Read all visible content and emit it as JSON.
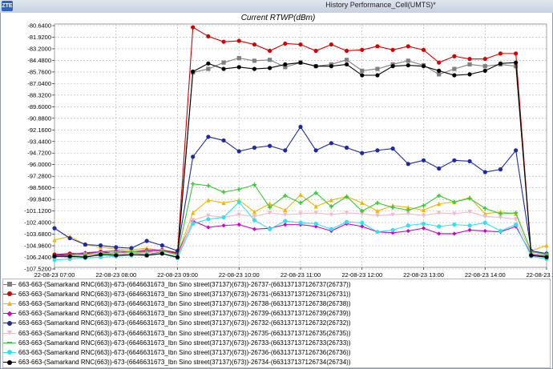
{
  "window": {
    "title": "History Performance_Cell(UMTS)*",
    "icon": "zte-logo-icon",
    "icon_text": "ZTE"
  },
  "chart_data": {
    "type": "line",
    "title": "Current RTWP(dBm)",
    "xlabel": "",
    "ylabel": "",
    "x_ticks": [
      "22-08-23 07:00",
      "22-08-23 08:00",
      "22-08-23 09:00",
      "22-08-23 10:00",
      "22-08-23 11:00",
      "22-08-23 12:00",
      "22-08-23 13:00",
      "22-08-23 14:00",
      "22-08-23 15:00"
    ],
    "y_ticks": [
      "-80.6400",
      "-81.9200",
      "-83.2000",
      "-84.4800",
      "-85.7600",
      "-87.0400",
      "-88.3200",
      "-89.6000",
      "-90.8800",
      "-92.1600",
      "-93.4400",
      "-94.7200",
      "-96.0000",
      "-97.2800",
      "-98.5600",
      "-99.8400",
      "-101.1200",
      "-102.4000",
      "-103.6800",
      "-104.9600",
      "-106.2400",
      "-107.5200"
    ],
    "ylim": [
      -107.52,
      -80.64
    ],
    "x_range_hours": [
      7.0,
      15.0
    ],
    "x_start_date": "22-08-23",
    "grid": true,
    "legend_position": "bottom",
    "x": [
      7.0,
      7.25,
      7.5,
      7.75,
      8.0,
      8.25,
      8.5,
      8.75,
      9.0,
      9.25,
      9.5,
      9.75,
      10.0,
      10.25,
      10.5,
      10.75,
      11.0,
      11.25,
      11.5,
      11.75,
      12.0,
      12.25,
      12.5,
      12.75,
      13.0,
      13.25,
      13.5,
      13.75,
      14.0,
      14.25,
      14.5,
      14.75,
      15.0
    ],
    "series": [
      {
        "name": "663-663-(Samarkand RNC(663))-673-(6646631673_Ibn Sino street(37137)(673))-26737-(66313713712673​7(26737))",
        "color": "#808080",
        "marker": "square",
        "values": [
          -106.3,
          -106.4,
          -106.3,
          -106.2,
          -106.0,
          -105.9,
          -106.1,
          -105.8,
          -105.9,
          -86.0,
          -85.6,
          -84.9,
          -84.4,
          -84.7,
          -84.6,
          -85.4,
          -84.9,
          -85.3,
          -85.1,
          -84.6,
          -85.8,
          -85.6,
          -85.1,
          -84.7,
          -85.2,
          -86.2,
          -85.6,
          -85.1,
          -85.3,
          -85.1,
          -85.3,
          -106.0,
          -106.2
        ]
      },
      {
        "name": "663-663-(Samarkand RNC(663))-673-(6646631673_Ibn Sino street(37137)(673))-26731-(663137137126731(26731))",
        "color": "#d80000",
        "marker": "circle",
        "values": [
          -106.1,
          -106.0,
          -106.0,
          -105.8,
          -106.0,
          -105.9,
          -105.8,
          -105.6,
          -105.9,
          -81.0,
          -82.0,
          -82.6,
          -82.5,
          -82.9,
          -83.6,
          -82.8,
          -82.9,
          -83.6,
          -82.9,
          -83.6,
          -83.5,
          -83.1,
          -83.5,
          -83.1,
          -83.5,
          -84.9,
          -84.2,
          -84.5,
          -84.5,
          -83.9,
          -83.9,
          -106.1,
          -106.3
        ]
      },
      {
        "name": "663-663-(Samarkand RNC(663))-673-(6646631673_Ibn Sino street(37137)(673))-26738-(663137137126738(26738))",
        "color": "#f0b800",
        "marker": "triangle",
        "values": [
          -104.5,
          -104.1,
          -105.0,
          -105.3,
          -105.5,
          -105.6,
          -105.4,
          -105.7,
          -106.1,
          -101.5,
          -100.1,
          -100.4,
          -100.1,
          -101.4,
          -100.5,
          -101.2,
          -99.5,
          -100.8,
          -100.1,
          -99.7,
          -100.4,
          -101.3,
          -100.7,
          -100.9,
          -101.2,
          -100.5,
          -100.3,
          -99.8,
          -101.6,
          -101.4,
          -101.6,
          -105.7,
          -105.1
        ]
      },
      {
        "name": "663-663-(Samarkand RNC(663))-673-(6646631673_Ibn Sino street(37137)(673))-26739-(663137137126739(26739))",
        "color": "#d000d0",
        "marker": "diamond",
        "values": [
          -106.2,
          -106.1,
          -105.9,
          -105.8,
          -105.7,
          -105.8,
          -105.6,
          -105.6,
          -106.0,
          -102.4,
          -103.1,
          -102.9,
          -102.8,
          -103.3,
          -103.2,
          -102.8,
          -102.8,
          -103.0,
          -103.5,
          -102.7,
          -103.0,
          -103.6,
          -103.7,
          -103.5,
          -103.2,
          -103.8,
          -103.8,
          -103.4,
          -103.5,
          -103.6,
          -103.0,
          -106.1,
          -106.2
        ]
      },
      {
        "name": "663-663-(Samarkand RNC(663))-673-(6646631673_Ibn Sino street(37137)(673))-26732-(663137137126732(26732))",
        "color": "#1a2aa8",
        "marker": "circle",
        "values": [
          -103.2,
          -104.3,
          -105.0,
          -105.1,
          -105.3,
          -105.4,
          -104.6,
          -105.1,
          -105.7,
          -95.3,
          -93.1,
          -93.5,
          -94.7,
          -94.3,
          -94.1,
          -94.6,
          -92.0,
          -94.6,
          -93.8,
          -94.3,
          -94.9,
          -94.6,
          -94.4,
          -96.1,
          -95.7,
          -96.6,
          -95.7,
          -95.8,
          -97.0,
          -96.7,
          -94.6,
          -105.7,
          -106.0
        ]
      },
      {
        "name": "663-663-(Samarkand RNC(663))-673-(6646631673_Ibn Sino street(37137)(673))-26735-(663137137126735(26735))",
        "color": "#f4b8c8",
        "marker": "triangle-down",
        "values": [
          -106.4,
          -106.3,
          -106.1,
          -106.0,
          -106.0,
          -105.9,
          -105.9,
          -105.7,
          -106.3,
          -102.3,
          -101.8,
          -102.0,
          -101.7,
          -101.9,
          -101.5,
          -101.7,
          -101.6,
          -101.5,
          -101.7,
          -101.5,
          -101.6,
          -101.8,
          -101.7,
          -101.6,
          -101.8,
          -101.5,
          -101.6,
          -101.4,
          -101.9,
          -102.0,
          -102.2,
          -106.0,
          -106.2
        ]
      },
      {
        "name": "663-663-(Samarkand RNC(663))-673-(6646631673_Ibn Sino street(37137)(673))-26733-(663137137126733(26733))",
        "color": "#33cc33",
        "marker": "cross",
        "values": [
          -106.3,
          -106.2,
          -106.1,
          -106.0,
          -105.9,
          -105.8,
          -105.7,
          -105.7,
          -106.1,
          -98.3,
          -98.5,
          -99.2,
          -98.9,
          -98.4,
          -100.9,
          -99.6,
          -100.4,
          -99.3,
          -100.8,
          -99.7,
          -101.3,
          -100.4,
          -100.9,
          -101.2,
          -100.7,
          -99.6,
          -100.3,
          -99.9,
          -101.0,
          -101.6,
          -101.5,
          -105.8,
          -106.1
        ]
      },
      {
        "name": "663-663-(Samarkand RNC(663))-673-(6646631673_Ibn Sino street(37137)(673))-26736-(663137137126736(26736))",
        "color": "#33e0f0",
        "marker": "circle",
        "values": [
          -106.7,
          -106.6,
          -106.5,
          -106.4,
          -106.3,
          -106.2,
          -106.1,
          -106.0,
          -106.5,
          -102.7,
          -102.2,
          -102.0,
          -100.3,
          -102.3,
          -103.3,
          -102.4,
          -102.6,
          -102.7,
          -103.3,
          -102.5,
          -102.6,
          -103.6,
          -103.4,
          -102.9,
          -102.7,
          -103.0,
          -102.8,
          -102.9,
          -102.6,
          -103.5,
          -102.8,
          -106.3,
          -106.6
        ]
      },
      {
        "name": "663-663-(Samarkand RNC(663))-673-(6646631673_Ibn Sino street(37137)(673))-26734-(663137137126734(26734))",
        "color": "#000000",
        "marker": "circle",
        "values": [
          -106.3,
          -106.3,
          -106.4,
          -106.1,
          -106.2,
          -106.1,
          -106.2,
          -106.0,
          -106.4,
          -85.9,
          -85.0,
          -85.6,
          -85.4,
          -85.6,
          -85.5,
          -85.1,
          -84.9,
          -85.3,
          -85.3,
          -85.1,
          -86.3,
          -86.3,
          -85.3,
          -85.2,
          -85.3,
          -85.8,
          -86.3,
          -86.2,
          -85.8,
          -85.0,
          -84.9,
          -106.2,
          -106.4
        ]
      }
    ]
  }
}
